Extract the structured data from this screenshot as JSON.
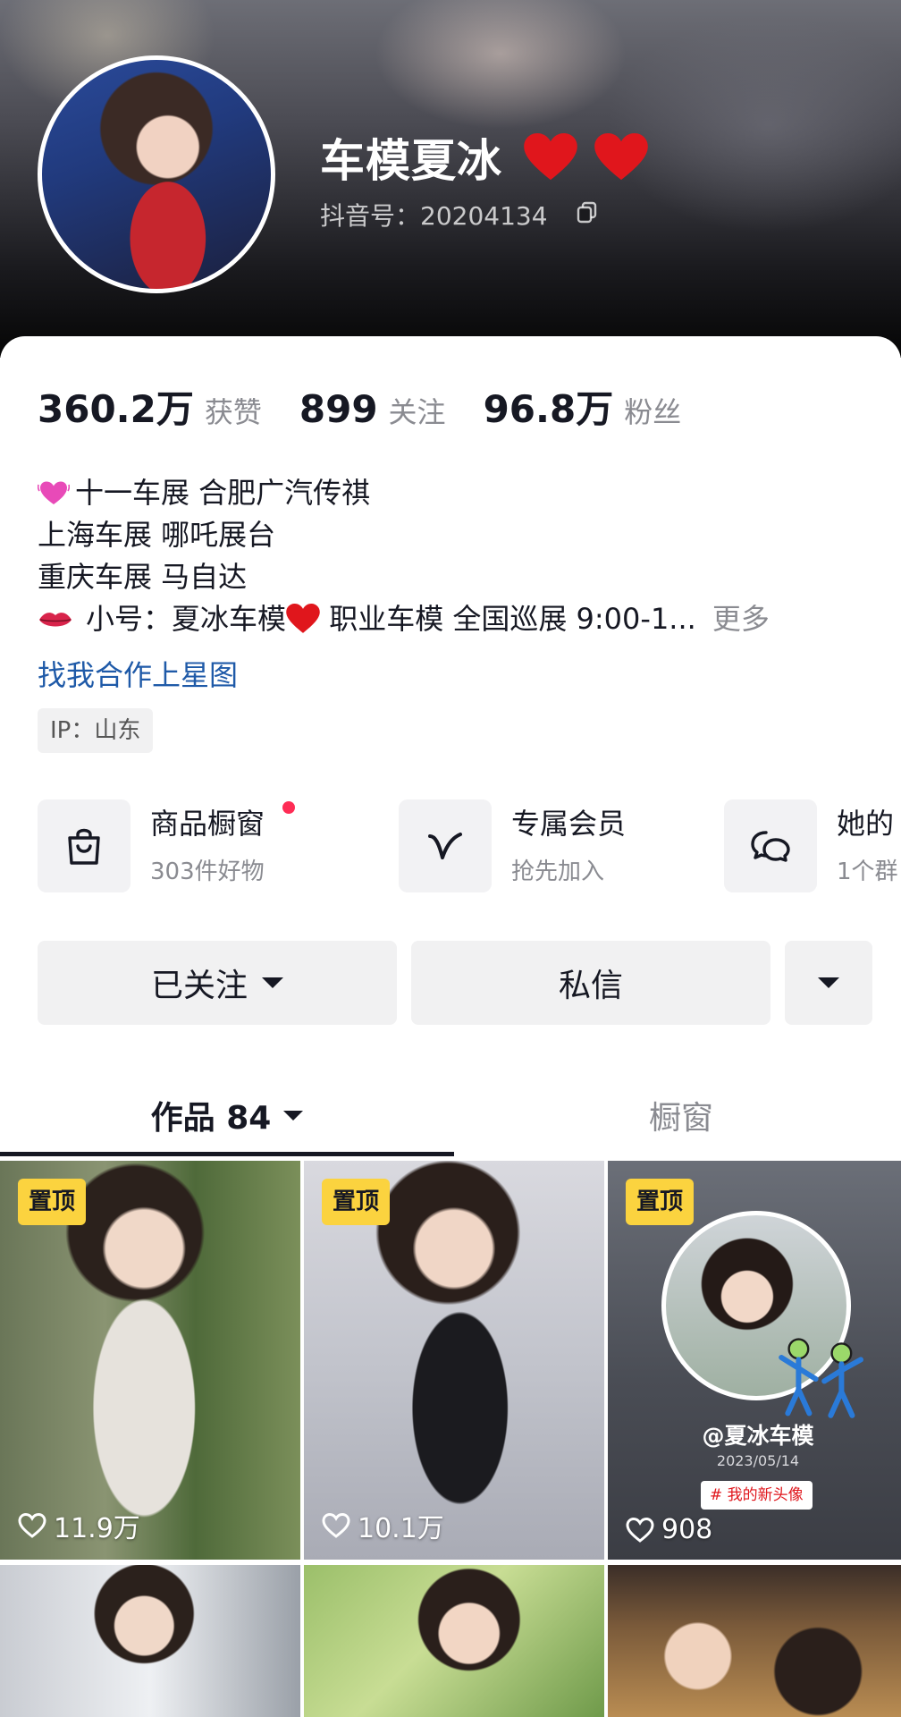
{
  "profile": {
    "name": "车模夏冰",
    "douyin_id": "抖音号：20204134"
  },
  "stats": [
    {
      "value": "360.2万",
      "label": "获赞"
    },
    {
      "value": "899",
      "label": "关注"
    },
    {
      "value": "96.8万",
      "label": "粉丝"
    }
  ],
  "bio": {
    "line1": "十一车展 合肥广汽传祺",
    "line2": "上海车展 哪吒展台",
    "line3": "重庆车展 马自达",
    "line4_a": "小号：夏冰车模",
    "line4_b": " 职业车模 全国巡展  9:00-1...",
    "more": "更多",
    "star_link": "找我合作上星图",
    "ip": "IP：山东"
  },
  "services": [
    {
      "title": "商品橱窗",
      "subtitle": "303件好物",
      "icon": "shopping-bag-icon"
    },
    {
      "title": "专属会员",
      "subtitle": "抢先加入",
      "icon": "vip-v-icon"
    },
    {
      "title": "她的",
      "subtitle": "1个群",
      "icon": "group-chat-icon"
    }
  ],
  "actions": {
    "followed_label": "已关注",
    "message_label": "私信"
  },
  "tabs": {
    "works": "作品 84",
    "showcase": "橱窗"
  },
  "videos": [
    {
      "pinned": "置顶",
      "likes": "11.9万"
    },
    {
      "pinned": "置顶",
      "likes": "10.1万"
    },
    {
      "pinned": "置顶",
      "likes": "908",
      "overlay_name": "@夏冰车模",
      "overlay_date": "2023/05/14",
      "overlay_tag": "# 我的新头像"
    }
  ],
  "colors": {
    "accent_red": "#fe2c55",
    "pin_yellow": "#fbd33f",
    "link_blue": "#1f5aa8"
  }
}
